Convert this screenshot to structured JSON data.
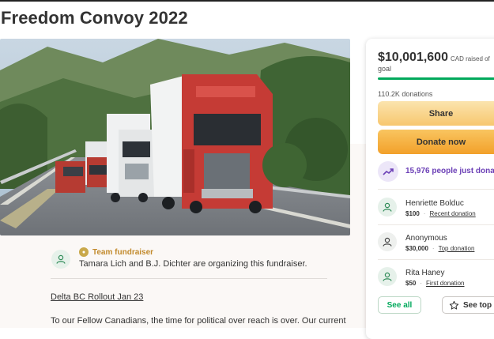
{
  "page": {
    "title": "Freedom Convoy 2022"
  },
  "hero": {
    "image_alt": "Convoy of trucks on a highway"
  },
  "organizer": {
    "badge": "Team fundraiser",
    "text": "Tamara Lich and B.J. Dichter are organizing this fundraiser."
  },
  "story": {
    "heading_link": "Delta BC Rollout Jan 23",
    "first_line": "To our Fellow Canadians, the time for political over reach is over.  Our current"
  },
  "donation_card": {
    "amount": "$10,001,600",
    "currency_suffix": "CAD raised of",
    "goal_text": "goal",
    "progress_fraction": 1.0,
    "donations_count": "110.2K donations",
    "share_label": "Share",
    "donate_label": "Donate now",
    "trend_text": "15,976 people just dona",
    "donors": [
      {
        "name": "Henriette Bolduc",
        "amount": "$100",
        "tag": "Recent donation",
        "avatar": "green"
      },
      {
        "name": "Anonymous",
        "amount": "$30,000",
        "tag": "Top donation",
        "avatar": "grey"
      },
      {
        "name": "Rita Haney",
        "amount": "$50",
        "tag": "First donation",
        "avatar": "green"
      }
    ],
    "see_all_label": "See all",
    "see_top_label": "See top"
  },
  "colors": {
    "brand_green": "#02a95c",
    "donate_orange": "#f2a02a",
    "share_yellow": "#f7c76f",
    "trend_purple": "#6b3fb6",
    "team_gold": "#c28a2c"
  }
}
